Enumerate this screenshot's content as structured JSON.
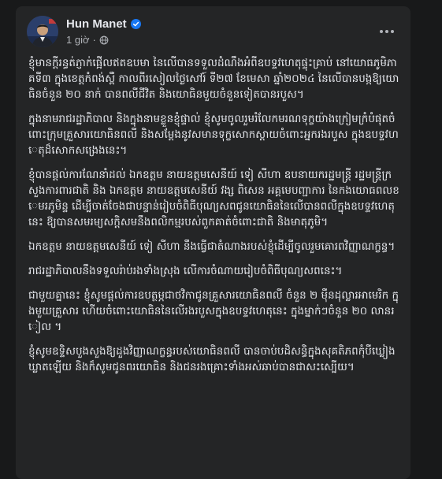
{
  "post": {
    "author": "Hun Manet",
    "time": "1 giờ",
    "icons": {
      "verified": "verified-badge-icon",
      "audience": "globe-icon",
      "more": "more-options-icon"
    },
    "paragraphs": [
      "ខ្ញុំមានក្តីរន្ធត់ភ្ញាក់ផ្អើលឥតឧបមា នៃលើបានទទួលដំណឹងអំពីឧបទ្ទវហេតុផ្ទុះគ្រាប់ នៅយោធភូមិភាគទី៣ ក្នុងខេត្តកំពង់ស្ពឺ កាលពីរសៀលថ្ងៃសៅរ៍ ទី២៧ ខែមេសា ឆ្នាំ២០២៤ នៃលើបានបង្កឱ្យយោធិនចំនួន ២០ នាក់ បានពលីជីវិត និងយោធិនមួយចំនួនទៀតបានរបួស។",
      "ក្នុងនាមរាជរដ្ឋាភិបាល និងក្នុងនាមខ្លួនខ្ញុំផ្ទាល់ ខ្ញុំសូមចូលរួមរំលែកមរណទុក្ខយ៉ាងក្រៀមក្រំបំផុតចំពោះក្រុមគ្រួសារយោធិនពលី និងសម្តែងនូវសមានទុក្ខសោកស្តាយចំពោះអ្នករងរបួស ក្នុងឧបទ្ទវហេតុដ៏សោកសង្រេងនេះ។",
      "ខ្ញុំបានផ្តល់ការណែនាំដល់ ឯកឧត្តម នាយឧត្តមសេនីយ៍ ទៀ សីហា ឧបនាយករដ្ឋមន្ត្រី រដ្ឋមន្ត្រីក្រសួងការពារជាតិ និង ឯកឧត្តម នាយឧត្តមសេនីយ៍ វង្ស ពិសេន អគ្គមេបញ្ជាការ នៃកងយោធពលខេមរភូមិន្ទ ដើម្បីចាត់ចែងជាបន្ទាន់រៀបចំពិធីបុណ្យសពជូនយោធិននៃលើបានពលីក្នុងឧបទ្ទវហេតុនេះ ឱ្យបានសមរម្យសក្តិសមនឹងពលិកម្មរបស់ពួកគាត់ចំពោះជាតិ និងមាតុភូមិ។",
      "ឯកឧត្តម នាយឧត្តមសេនីយ៍ ទៀ សីហា នឹងធ្វើជាតំណាងរបស់ខ្ញុំដើម្បីចូលរួមគោរពវិញ្ញាណក្ខន្ធ។",
      "រាជរដ្ឋាភិបាលនឹងទទួលរ៉ាប់រងទាំងស្រុង លើការចំណាយរៀបចំពិធីបុណ្យសពនេះ។",
      "ជាមួយគ្នានេះ ខ្ញុំសូមផ្តល់ការឧបត្ថម្ភជាថវិកាជូនគ្រួសារយោធិនពលី ចំនួន ២ ម៉ឺនដុល្លារអាមេរិក ក្នុងមួយគ្រួសារ ហើយចំពោះយោធិននៃលើរងរបួសក្នុងឧបទ្ទវហេតុនេះ ក្នុងម្នាក់ៗចំនួន ២០ លានរៀល ។",
      "ខ្ញុំសូមឧទ្ទិសបួងសួងឱ្យដួងវិញ្ញាណក្ខន្ធរបស់យោធិនពលី បានចាប់បដិសន្ធិក្នុងសុគតិភពកុំបីឃ្លៀងឃ្លាតឡើយ និងក៏សូមជូនពរយោធិន និងជនរងគ្រោះទាំងអស់ឆាប់បានជាសះស្បើយ។"
    ]
  }
}
